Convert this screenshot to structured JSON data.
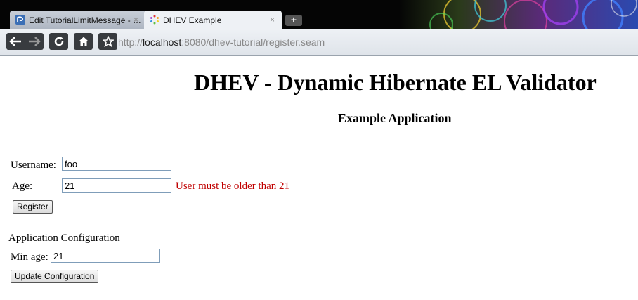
{
  "browser": {
    "tabs": [
      {
        "title": "Edit TutorialLimitMessage - …",
        "close": "×",
        "icon": "confluence-favicon-icon",
        "active": false
      },
      {
        "title": "DHEV Example",
        "close": "×",
        "icon": "loading-spinner-icon",
        "active": true
      }
    ],
    "new_tab_label": "+",
    "address": {
      "scheme": "http://",
      "host": "localhost",
      "rest": ":8080/dhev-tutorial/register.seam"
    }
  },
  "page": {
    "title": "DHEV - Dynamic Hibernate EL Validator",
    "subtitle": "Example Application",
    "register_form": {
      "username_label": "Username:",
      "username_value": "foo",
      "age_label": "Age:",
      "age_value": "21",
      "age_error": "User must be older than 21",
      "register_button": "Register"
    },
    "config_form": {
      "heading": "Application Configuration",
      "min_age_label": "Min age:",
      "min_age_value": "21",
      "update_button": "Update Configuration"
    }
  },
  "colors": {
    "error": "#c00000",
    "tabbar": "#050505"
  }
}
